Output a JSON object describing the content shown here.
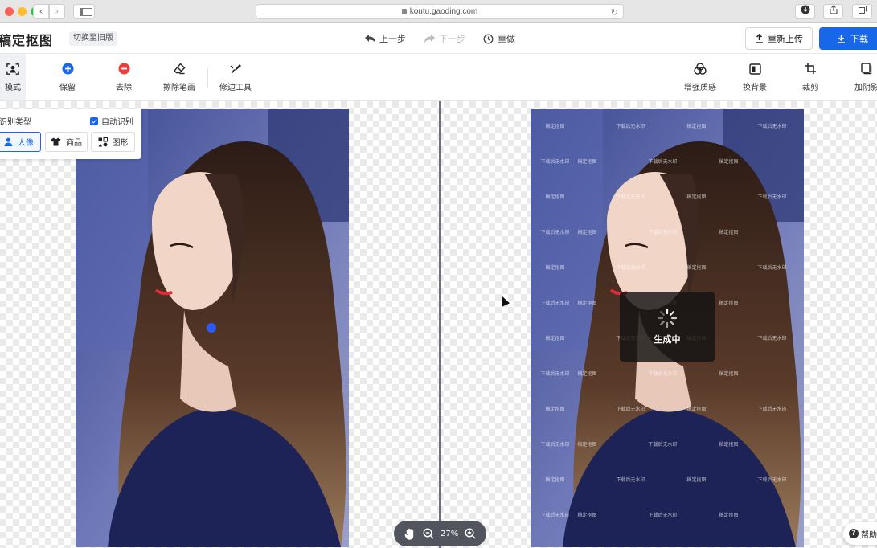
{
  "browser": {
    "url": "koutu.gaoding.com",
    "nav_back_icon": "chevron-left-icon",
    "nav_forward_icon": "chevron-right-icon"
  },
  "header": {
    "logo": "稿定抠图",
    "old_version": "切换至旧版",
    "undo": "上一步",
    "redo": "下一步",
    "reset": "重做",
    "reupload": "重新上传",
    "download": "下载",
    "download_color": "#1867e8"
  },
  "toolbar": {
    "mode": "模式",
    "keep": "保留",
    "remove": "去除",
    "erase_stroke": "擦除笔画",
    "edge_tool": "修边工具",
    "enhance": "增强质感",
    "change_bg": "换背景",
    "crop": "裁剪",
    "add_shadow": "加阴影",
    "keep_color": "#1867e8",
    "remove_color": "#e8413d"
  },
  "type_panel": {
    "title": "识别类型",
    "auto_detect": "自动识别",
    "auto_detect_checked": true,
    "options": [
      {
        "label": "人像",
        "selected": true
      },
      {
        "label": "商品",
        "selected": false
      },
      {
        "label": "图形",
        "selected": false
      }
    ]
  },
  "canvas": {
    "loading_text": "生成中",
    "zoom": "27%",
    "help": "帮助",
    "watermarks": [
      "稿定抠图",
      "下载后无水印"
    ]
  }
}
